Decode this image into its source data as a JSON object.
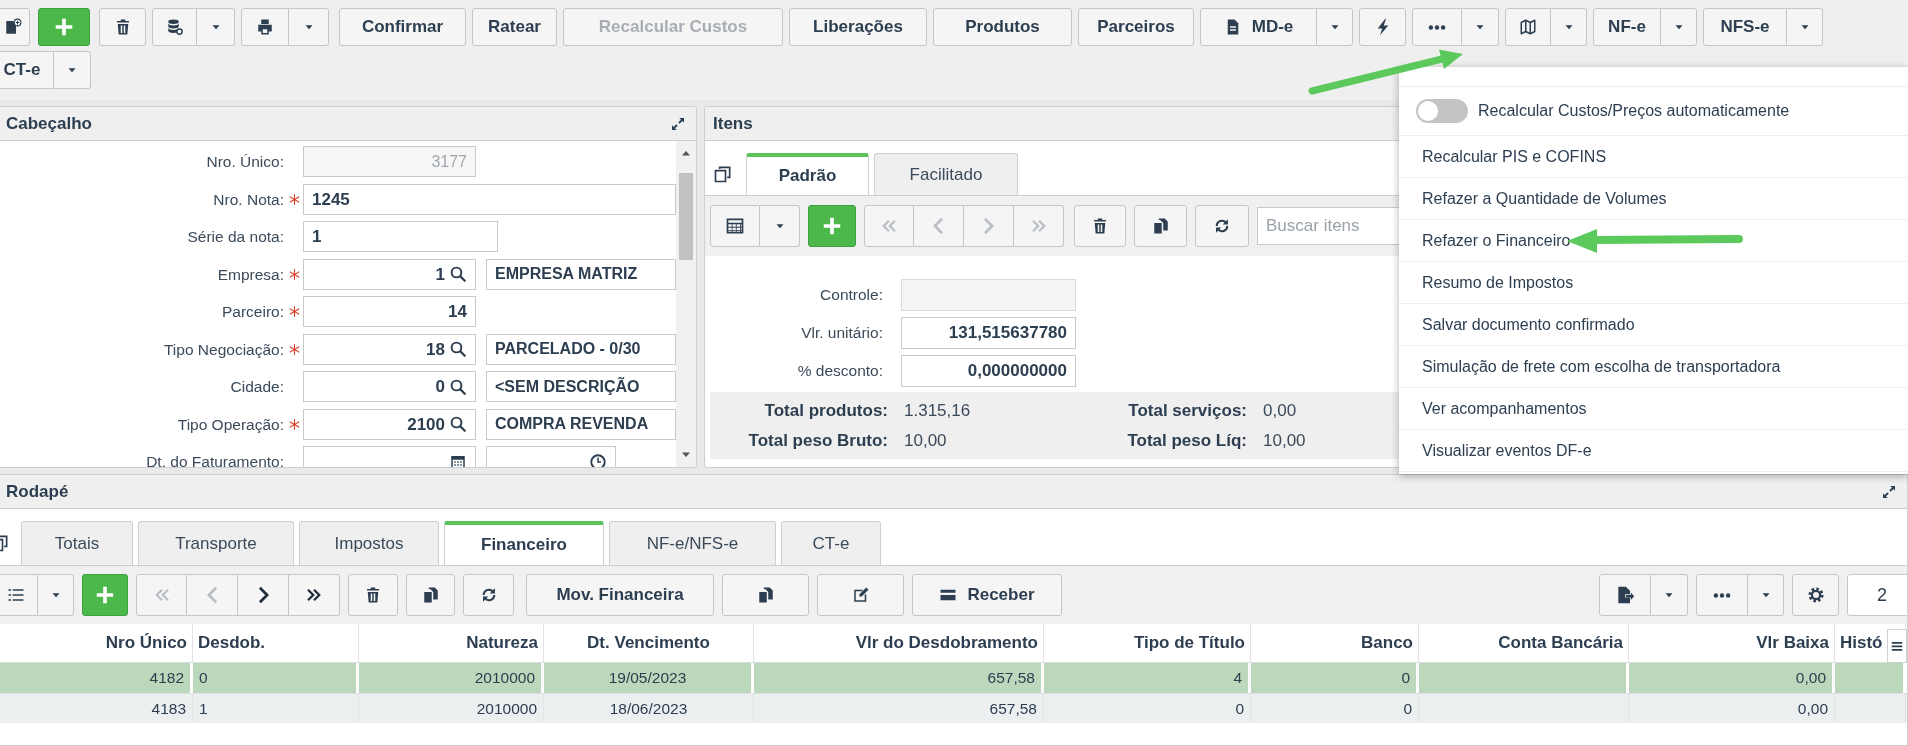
{
  "toolbar": {
    "buttons": [
      {
        "label": "Confirmar",
        "disabled": false
      },
      {
        "label": "Ratear",
        "disabled": false
      },
      {
        "label": "Recalcular Custos",
        "disabled": true
      },
      {
        "label": "Liberações",
        "disabled": false
      },
      {
        "label": "Produtos",
        "disabled": false
      },
      {
        "label": "Parceiros",
        "disabled": false
      }
    ],
    "split_buttons": [
      {
        "label": "MD-e"
      },
      {
        "label": "NF-e"
      },
      {
        "label": "NFS-e"
      },
      {
        "label": "CT-e"
      }
    ]
  },
  "more_menu": {
    "open": true,
    "items": [
      {
        "kind": "toggle",
        "label": "Recalcular Custos/Preços automaticamente",
        "on": false
      },
      {
        "kind": "action",
        "label": "Recalcular PIS e COFINS"
      },
      {
        "kind": "action",
        "label": "Refazer a Quantidade de Volumes"
      },
      {
        "kind": "action",
        "label": "Refazer o Financeiro"
      },
      {
        "kind": "action",
        "label": "Resumo de Impostos"
      },
      {
        "kind": "action",
        "label": "Salvar documento confirmado"
      },
      {
        "kind": "action",
        "label": "Simulação de frete com escolha de transportadora"
      },
      {
        "kind": "action",
        "label": "Ver acompanhamentos"
      },
      {
        "kind": "action",
        "label": "Visualizar eventos DF-e"
      }
    ]
  },
  "header": {
    "title": "Cabeçalho",
    "fields": [
      {
        "label": "Nro. Único:",
        "required": false,
        "kind": "readonly",
        "value": "3177"
      },
      {
        "label": "Nro. Nota:",
        "required": true,
        "kind": "wide",
        "value": "1245"
      },
      {
        "label": "Série da nota:",
        "required": false,
        "kind": "short",
        "value": "1"
      },
      {
        "label": "Empresa:",
        "required": true,
        "kind": "lookup",
        "value": "1",
        "description": "EMPRESA MATRIZ"
      },
      {
        "label": "Parceiro:",
        "required": true,
        "kind": "code",
        "value": "14"
      },
      {
        "label": "Tipo Negociação:",
        "required": true,
        "kind": "lookup",
        "value": "18",
        "description": "PARCELADO - 0/30"
      },
      {
        "label": "Cidade:",
        "required": false,
        "kind": "lookup",
        "value": "0",
        "description": "<SEM DESCRIÇÃO"
      },
      {
        "label": "Tipo Operação:",
        "required": true,
        "kind": "lookup",
        "value": "2100",
        "description": "COMPRA REVENDA"
      },
      {
        "label": "Dt. do Faturamento:",
        "required": false,
        "kind": "datetime"
      }
    ]
  },
  "items": {
    "title": "Itens",
    "tabs": [
      {
        "label": "Padrão",
        "selected": true
      },
      {
        "label": "Facilitado",
        "selected": false
      }
    ],
    "navigation": [
      {
        "disabled": true
      },
      {
        "disabled": true
      },
      {
        "disabled": true
      },
      {
        "disabled": true
      }
    ],
    "search": {
      "placeholder": "Buscar itens"
    },
    "fields": [
      {
        "label": "Controle:",
        "readonly": true
      },
      {
        "label": "Vlr. unitário:",
        "readonly": false,
        "value": "131,515637780"
      },
      {
        "label": "% desconto:",
        "readonly": false,
        "value": "0,000000000"
      }
    ],
    "totals": [
      {
        "label": "Total produtos:",
        "value": "1.315,16"
      },
      {
        "label": "Total serviços:",
        "value": "0,00"
      },
      {
        "label": "Total peso Bruto:",
        "value": "10,00"
      },
      {
        "label": "Total peso Líq:",
        "value": "10,00"
      }
    ]
  },
  "footer": {
    "title": "Rodapé",
    "tabs": [
      {
        "label": "Totais",
        "selected": false
      },
      {
        "label": "Transporte",
        "selected": false
      },
      {
        "label": "Impostos",
        "selected": false
      },
      {
        "label": "Financeiro",
        "selected": true
      },
      {
        "label": "NF-e/NFS-e",
        "selected": false
      },
      {
        "label": "CT-e",
        "selected": false
      }
    ],
    "navigation": [
      {
        "disabled": true
      },
      {
        "disabled": true
      },
      {
        "disabled": false
      },
      {
        "disabled": false
      }
    ],
    "buttons": [
      {
        "label": "Mov. Financeira"
      },
      {
        "label": "Receber"
      }
    ],
    "page": "2",
    "table": {
      "columns": [
        "Nro Único",
        "Desdob.",
        "Natureza",
        "Dt. Vencimento",
        "Vlr do Desdobramento",
        "Tipo de Título",
        "Banco",
        "Conta Bancária",
        "Vlr Baixa",
        "Histó"
      ],
      "rows": [
        {
          "selected": true,
          "cells": [
            "4182",
            "0",
            "2010000",
            "19/05/2023",
            "657,58",
            "4",
            "0",
            null,
            "0,00",
            null
          ]
        },
        {
          "selected": false,
          "cells": [
            "4183",
            "1",
            "2010000",
            "18/06/2023",
            "657,58",
            "0",
            "0",
            null,
            "0,00",
            null
          ]
        }
      ]
    }
  }
}
